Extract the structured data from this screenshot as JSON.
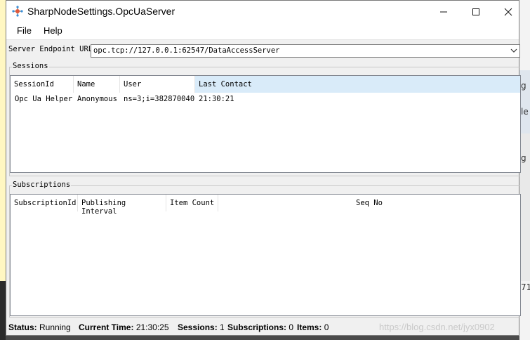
{
  "window": {
    "title": "SharpNodeSettings.OpcUaServer",
    "minimize_glyph": "—",
    "maximize_glyph": "☐",
    "close_glyph": "✕",
    "app_icon": "network-node-icon"
  },
  "menu": {
    "items": [
      "File",
      "Help"
    ]
  },
  "endpoint": {
    "label": "Server Endpoint URLs",
    "value": "opc.tcp://127.0.0.1:62547/DataAccessServer"
  },
  "sessions": {
    "group_label": "Sessions",
    "columns": [
      "SessionId",
      "Name",
      "User",
      "Last Contact"
    ],
    "rows": [
      [
        "Opc Ua Helper",
        "Anonymous",
        "ns=3;i=382870040",
        "21:30:21"
      ]
    ]
  },
  "subscriptions": {
    "group_label": "Subscriptions",
    "columns": [
      "SubscriptionId",
      "Publishing Interval",
      "Item Count",
      "Seq No"
    ],
    "rows": []
  },
  "status": {
    "status_label": "Status:",
    "status_value": "Running",
    "time_label": "Current Time:",
    "time_value": "21:30:25",
    "sessions_label": "Sessions:",
    "sessions_value": "1",
    "subscriptions_label": "Subscriptions:",
    "subscriptions_value": "0",
    "items_label": "Items:",
    "items_value": "0"
  },
  "watermark": "https://blog.csdn.net/jyx0902",
  "background": {
    "peek_chars": [
      "g",
      "le",
      "g",
      "71"
    ]
  },
  "colors": {
    "header_hot": "#d9ebf9",
    "window_bg": "#f0f0f0"
  }
}
